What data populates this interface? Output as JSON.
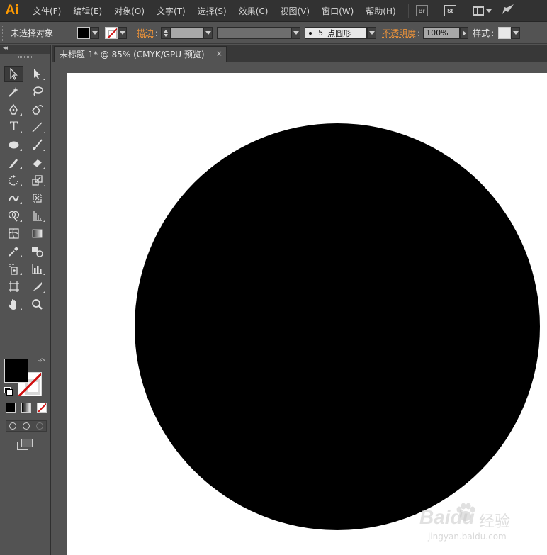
{
  "app": {
    "logo": "Ai"
  },
  "menubar": {
    "items": [
      "文件(F)",
      "编辑(E)",
      "对象(O)",
      "文字(T)",
      "选择(S)",
      "效果(C)",
      "视图(V)",
      "窗口(W)",
      "帮助(H)"
    ],
    "bridge_label": "Br",
    "stock_label": "St"
  },
  "controlbar": {
    "selection_status": "未选择对象",
    "stroke_label": "描边",
    "brush_size": "5",
    "brush_shape": "点圆形",
    "opacity_label": "不透明度",
    "opacity_value": "100%",
    "style_label": "样式"
  },
  "document": {
    "tab_title": "未标题-1* @ 85% (CMYK/GPU 预览)",
    "close_glyph": "×"
  },
  "toolpanel": {
    "collapse_glyph": "◂◂",
    "swap_glyph": "↶"
  },
  "colors": {
    "fill": "#000000",
    "stroke": "none",
    "accent_orange": "#e8913a",
    "logo_orange": "#ff9a00"
  },
  "watermark": {
    "brand": "Baidu",
    "cn": "经验",
    "url": "jingyan.baidu.com"
  }
}
